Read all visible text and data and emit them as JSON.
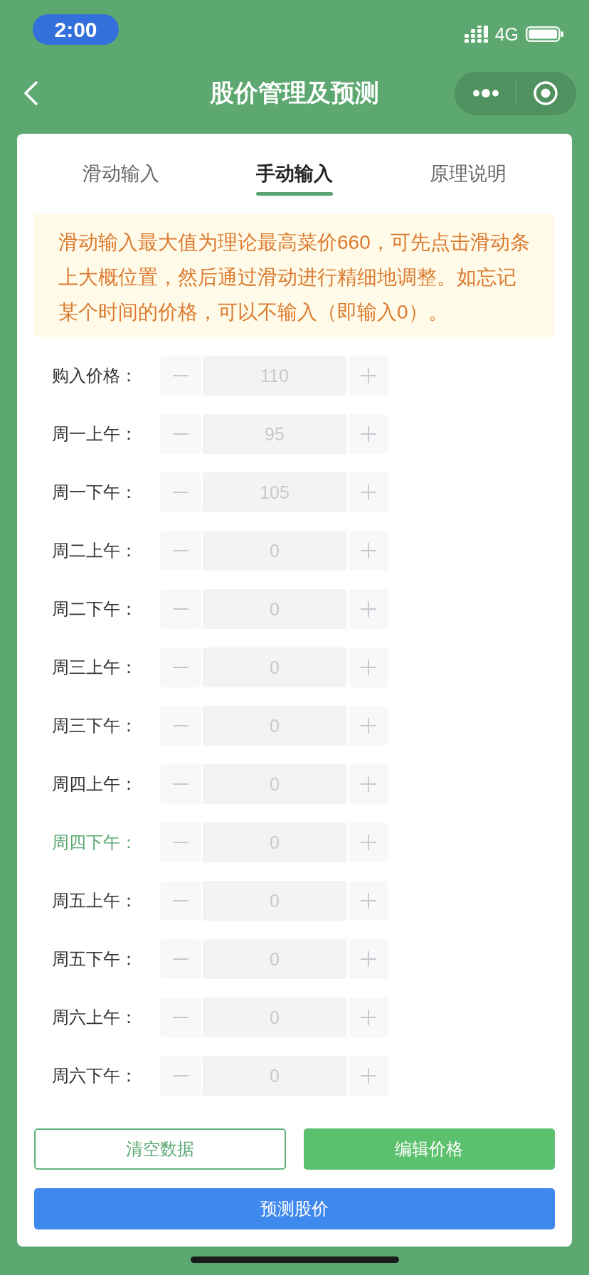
{
  "status_bar": {
    "time": "2:00",
    "network": "4G"
  },
  "nav_bar": {
    "title": "股价管理及预测"
  },
  "tabs": [
    {
      "label": "滑动输入",
      "selected": false
    },
    {
      "label": "手动输入",
      "selected": true
    },
    {
      "label": "原理说明",
      "selected": false
    }
  ],
  "notice": {
    "text": "滑动输入最大值为理论最高菜价660，可先点击滑动条上大概位置，然后通过滑动进行精细地调整。如忘记某个时间的价格，可以不输入（即输入0）。"
  },
  "price_rows": [
    {
      "label": "购入价格：",
      "value": "110",
      "highlighted": false,
      "disabled": true
    },
    {
      "label": "周一上午：",
      "value": "95",
      "highlighted": false,
      "disabled": true
    },
    {
      "label": "周一下午：",
      "value": "105",
      "highlighted": false,
      "disabled": true
    },
    {
      "label": "周二上午：",
      "value": "0",
      "highlighted": false,
      "disabled": true
    },
    {
      "label": "周二下午：",
      "value": "0",
      "highlighted": false,
      "disabled": true
    },
    {
      "label": "周三上午：",
      "value": "0",
      "highlighted": false,
      "disabled": true
    },
    {
      "label": "周三下午：",
      "value": "0",
      "highlighted": false,
      "disabled": true
    },
    {
      "label": "周四上午：",
      "value": "0",
      "highlighted": false,
      "disabled": true
    },
    {
      "label": "周四下午：",
      "value": "0",
      "highlighted": true,
      "disabled": true
    },
    {
      "label": "周五上午：",
      "value": "0",
      "highlighted": false,
      "disabled": true
    },
    {
      "label": "周五下午：",
      "value": "0",
      "highlighted": false,
      "disabled": true
    },
    {
      "label": "周六上午：",
      "value": "0",
      "highlighted": false,
      "disabled": true
    },
    {
      "label": "周六下午：",
      "value": "0",
      "highlighted": false,
      "disabled": true
    }
  ],
  "buttons": [
    {
      "label": "清空数据",
      "kind": "plain"
    },
    {
      "label": "编辑价格",
      "kind": "success"
    },
    {
      "label": "预测股价",
      "kind": "info"
    }
  ]
}
